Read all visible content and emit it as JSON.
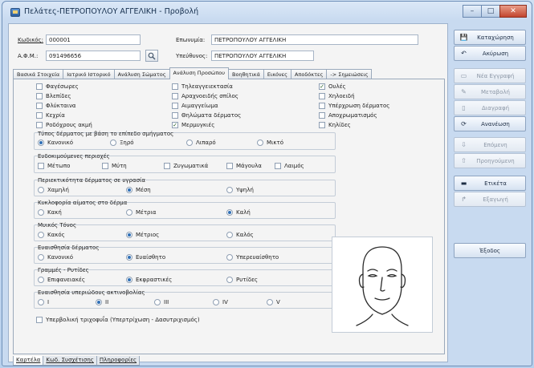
{
  "window": {
    "title": "Πελάτες-ΠΕΤΡΟΠΟΥΛΟΥ ΑΓΓΕΛΙΚΗ - Προβολή",
    "controls": {
      "minimize": "–",
      "maximize": "□",
      "close": "✕"
    }
  },
  "header": {
    "code_label": "Κωδικός:",
    "code_value": "000001",
    "surname_label": "Επωνυμία:",
    "surname_value": "ΠΕΤΡΟΠΟΥΛΟΥ ΑΓΓΕΛΙΚΗ",
    "afm_label": "Α.Φ.Μ.:",
    "afm_value": "091496656",
    "responsible_label": "Υπεύθυνος:",
    "responsible_value": "ΠΕΤΡΟΠΟΥΛΟΥ ΑΓΓΕΛΙΚΗ"
  },
  "tabs": [
    {
      "label": "Βασικά Στοιχεία",
      "active": false
    },
    {
      "label": "Ιατρικό Ιστορικό",
      "active": false
    },
    {
      "label": "Ανάλυση Σώματος",
      "active": false
    },
    {
      "label": "Ανάλυση Προσώπου",
      "active": true
    },
    {
      "label": "Βοηθητικά",
      "active": false
    },
    {
      "label": "Εικόνες",
      "active": false
    },
    {
      "label": "Αποδόκτες",
      "active": false
    },
    {
      "label": "-> Σημειώσεις",
      "active": false
    }
  ],
  "conditions": {
    "col1": [
      {
        "label": "Φαγέσωρες",
        "checked": false
      },
      {
        "label": "Βλεπίδες",
        "checked": false
      },
      {
        "label": "Φλύκταινα",
        "checked": false
      },
      {
        "label": "Κεχρία",
        "checked": false
      },
      {
        "label": "Ροδόχρους ακμή",
        "checked": false
      }
    ],
    "col2": [
      {
        "label": "Τηλεαγγειεκτασία",
        "checked": false
      },
      {
        "label": "Αραχνοειδής σπίλος",
        "checked": false
      },
      {
        "label": "Αιμαγγείωμα",
        "checked": false
      },
      {
        "label": "Θηλώματα δέρματος",
        "checked": false
      },
      {
        "label": "Μερμυγκιές",
        "checked": true
      }
    ],
    "col3": [
      {
        "label": "Ουλές",
        "checked": true
      },
      {
        "label": "Χηλοειδή",
        "checked": false
      },
      {
        "label": "Υπέρχρωση δέρματος",
        "checked": false
      },
      {
        "label": "Αποχρωματισμός",
        "checked": false
      },
      {
        "label": "Κηλίδες",
        "checked": false
      }
    ]
  },
  "skin_type": {
    "title": "Τύπος δέρματος με βάση το επίπεδο σμήγματος",
    "options": [
      "Κανονικό",
      "Ξηρό",
      "Λιπαρό",
      "Μικτό"
    ],
    "selected": 0
  },
  "sensitive_areas": {
    "title": "Ευδοκιμούμενες περιοχές",
    "options": [
      {
        "label": "Μέτωπο",
        "checked": false
      },
      {
        "label": "Μύτη",
        "checked": false
      },
      {
        "label": "Ζυγωματικά",
        "checked": false
      },
      {
        "label": "Μάγουλα",
        "checked": false
      },
      {
        "label": "Λαιμός",
        "checked": false
      }
    ]
  },
  "moisture": {
    "title": "Περιεκτικότητα δέρματος σε υγρασία",
    "options": [
      "Χαμηλή",
      "Μέση",
      "Υψηλή"
    ],
    "selected": 1
  },
  "circulation": {
    "title": "Κυκλοφορία αίματος στο δέρμα",
    "options": [
      "Κακή",
      "Μέτρια",
      "Καλή"
    ],
    "selected": 2
  },
  "muscle_tone": {
    "title": "Μυικός Τόνος",
    "options": [
      "Κακός",
      "Μέτριος",
      "Καλός"
    ],
    "selected": 1
  },
  "skin_sensitivity": {
    "title": "Ευαισθησία δέρματος",
    "options": [
      "Κανονικό",
      "Ευαίσθητο",
      "Υπερευαίσθητο"
    ],
    "selected": 1
  },
  "wrinkles": {
    "title": "Γραμμές - Ρυτίδες",
    "options": [
      "Επιφανειακές",
      "Εκφραστικές",
      "Ρυτίδες"
    ],
    "selected": 1
  },
  "uv_sensitivity": {
    "title": "Ευαισθησία υπεριώδους ακτινοβολίας",
    "options": [
      "I",
      "II",
      "III",
      "IV",
      "V"
    ],
    "selected": 1
  },
  "overpigmentation": {
    "label": "Υπερβολική τριχοφυΐα (Υπερτρίχωση - Δασυτριχισμός)",
    "checked": false
  },
  "bottom_tabs": [
    {
      "label": "Καρτέλα"
    },
    {
      "label": "Κωδ. Συσχέτισης"
    },
    {
      "label": "Πληροφορίες"
    }
  ],
  "sidebar": {
    "buttons": [
      {
        "label": "Καταχώρηση",
        "icon": "save-icon",
        "glyph": "💾",
        "enabled": true
      },
      {
        "label": "Ακύρωση",
        "icon": "undo-icon",
        "glyph": "↶",
        "enabled": true
      },
      {
        "label": "Νέα Εγγραφή",
        "icon": "new-record-icon",
        "glyph": "▭",
        "enabled": false
      },
      {
        "label": "Μεταβολή",
        "icon": "edit-icon",
        "glyph": "✎",
        "enabled": false
      },
      {
        "label": "Διαγραφή",
        "icon": "delete-icon",
        "glyph": "▯",
        "enabled": false
      },
      {
        "label": "Ανανέωση",
        "icon": "refresh-icon",
        "glyph": "⟳",
        "enabled": true
      },
      {
        "label": "Επόμενη",
        "icon": "next-icon",
        "glyph": "⇩",
        "enabled": false
      },
      {
        "label": "Προηγούμενη",
        "icon": "previous-icon",
        "glyph": "⇧",
        "enabled": false
      },
      {
        "label": "Ετικέτα",
        "icon": "label-icon",
        "glyph": "▬",
        "enabled": true
      },
      {
        "label": "Εξαγωγή",
        "icon": "export-icon",
        "glyph": "↱",
        "enabled": false
      },
      {
        "label": "Έξοδος",
        "icon": "exit-icon",
        "glyph": "",
        "enabled": true
      }
    ]
  },
  "colors": {
    "accent": "#2f6fb6",
    "titlebar": "#c8daf0",
    "panel": "#f4f4f4"
  }
}
